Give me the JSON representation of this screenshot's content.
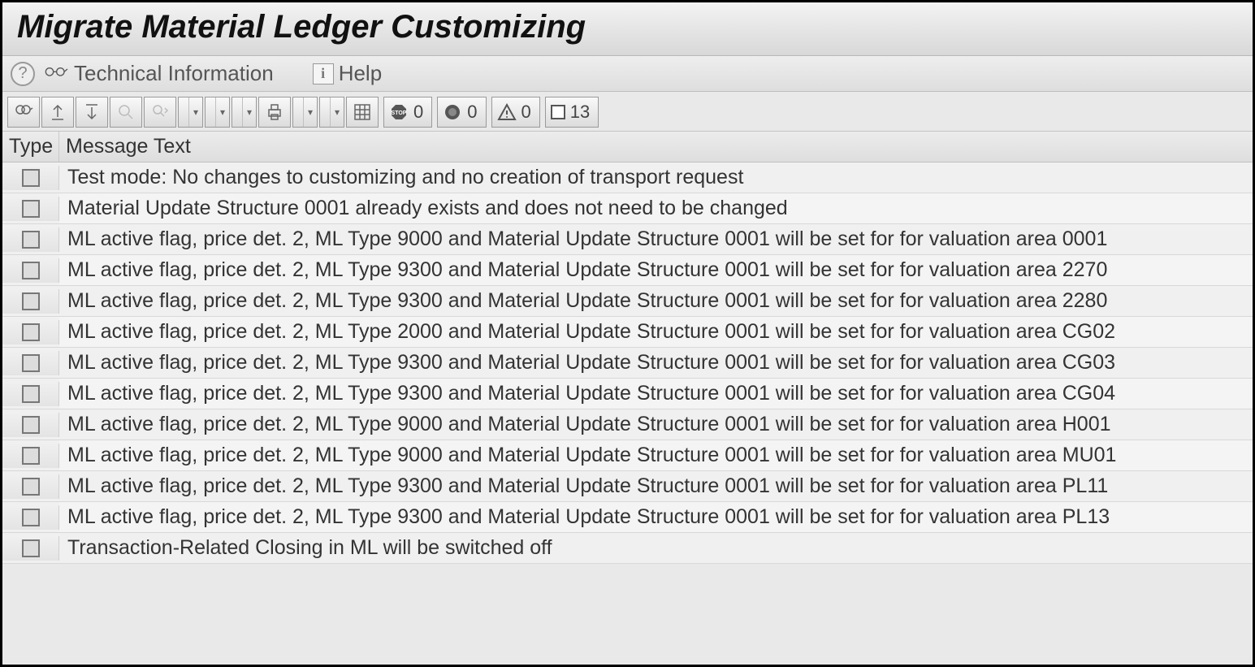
{
  "title": "Migrate Material Ledger Customizing",
  "secondary_toolbar": {
    "technical_info_label": "Technical Information",
    "help_label": "Help"
  },
  "status_counts": {
    "abort": "0",
    "error": "0",
    "warning": "0",
    "info": "13"
  },
  "columns": {
    "type": "Type",
    "message": "Message Text"
  },
  "messages": [
    {
      "text": "Test mode: No changes to customizing and no creation of transport request"
    },
    {
      "text": "Material Update Structure 0001 already exists and does not need to be changed"
    },
    {
      "text": "ML active flag, price det. 2, ML Type 9000 and Material Update Structure 0001 will be set for for valuation area 0001"
    },
    {
      "text": "ML active flag, price det. 2, ML Type 9300 and Material Update Structure 0001 will be set for for valuation area 2270"
    },
    {
      "text": "ML active flag, price det. 2, ML Type 9300 and Material Update Structure 0001 will be set for for valuation area 2280"
    },
    {
      "text": "ML active flag, price det. 2, ML Type 2000 and Material Update Structure 0001 will be set for for valuation area CG02"
    },
    {
      "text": "ML active flag, price det. 2, ML Type 9300 and Material Update Structure 0001 will be set for for valuation area CG03"
    },
    {
      "text": "ML active flag, price det. 2, ML Type 9300 and Material Update Structure 0001 will be set for for valuation area CG04"
    },
    {
      "text": "ML active flag, price det. 2, ML Type 9000 and Material Update Structure 0001 will be set for for valuation area H001"
    },
    {
      "text": "ML active flag, price det. 2, ML Type 9000 and Material Update Structure 0001 will be set for for valuation area MU01"
    },
    {
      "text": "ML active flag, price det. 2, ML Type 9300 and Material Update Structure 0001 will be set for for valuation area PL11"
    },
    {
      "text": "ML active flag, price det. 2, ML Type 9300 and Material Update Structure 0001 will be set for for valuation area PL13"
    },
    {
      "text": "Transaction-Related Closing in ML will be switched off"
    }
  ]
}
